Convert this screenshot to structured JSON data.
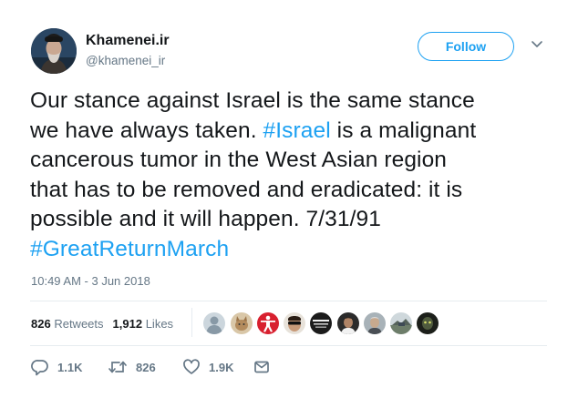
{
  "author": {
    "name": "Khamenei.ir",
    "handle": "@khamenei_ir"
  },
  "follow_button": {
    "label": "Follow"
  },
  "tweet": {
    "line1": "Our stance against Israel is the same stance",
    "line2_before": "we have always taken. ",
    "line2_hashtag": "#Israel",
    "line2_after": " is a malignant",
    "line3": "cancerous tumor in the West Asian region",
    "line4": "that has to be removed and eradicated: it is",
    "line5": "possible and it will happen. 7/31/91",
    "line6_hashtag": "#GreatReturnMarch"
  },
  "timestamp": "10:49 AM - 3 Jun 2018",
  "stats": {
    "retweets_count": "826",
    "retweets_label": "Retweets",
    "likes_count": "1,912",
    "likes_label": "Likes"
  },
  "likers": [
    {
      "icon": "default-avatar-icon"
    },
    {
      "icon": "cat-avatar-icon"
    },
    {
      "icon": "figure-avatar-icon"
    },
    {
      "icon": "sunglasses-avatar-icon"
    },
    {
      "icon": "text-avatar-icon"
    },
    {
      "icon": "portrait-avatar-icon"
    },
    {
      "icon": "portrait-avatar-icon"
    },
    {
      "icon": "landscape-avatar-icon"
    },
    {
      "icon": "dark-avatar-icon"
    }
  ],
  "actions": {
    "reply_count": "1.1K",
    "retweet_count": "826",
    "like_count": "1.9K"
  },
  "colors": {
    "accent": "#1da1f2",
    "text": "#14171a",
    "muted": "#657786",
    "divider": "#e6ecf0"
  }
}
